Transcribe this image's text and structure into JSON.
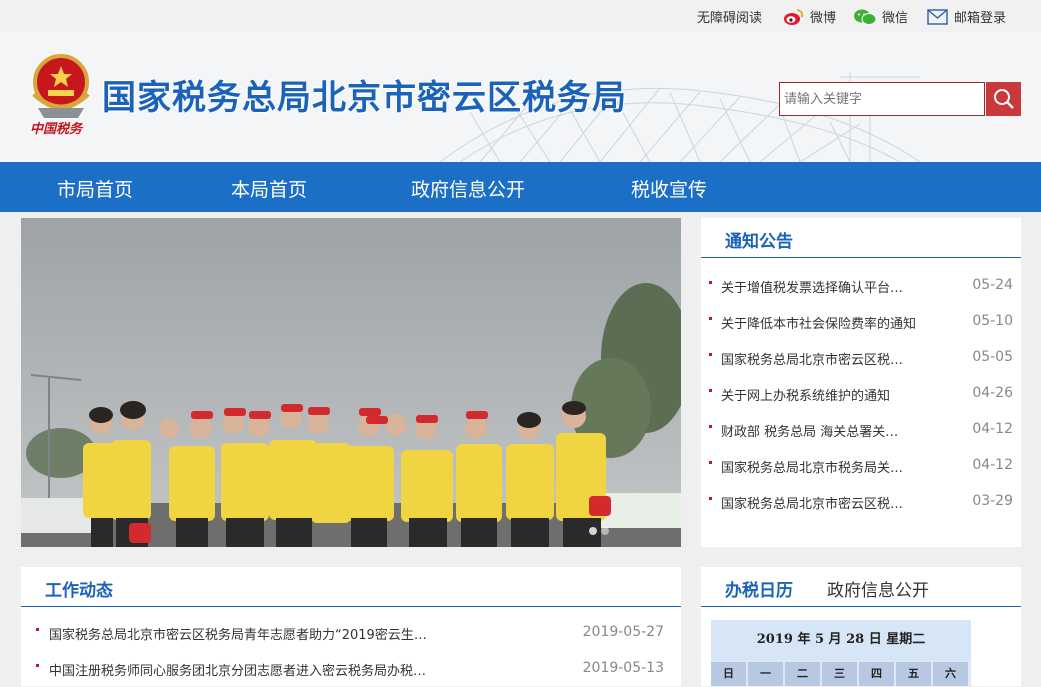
{
  "topbar": {
    "accessible": "无障碍阅读",
    "weibo": "微博",
    "wechat": "微信",
    "mail": "邮箱登录"
  },
  "header": {
    "emblem_caption": "中国税务",
    "title": "国家税务总局北京市密云区税务局",
    "search_placeholder": "请输入关键字"
  },
  "nav": [
    "市局首页",
    "本局首页",
    "政府信息公开",
    "税收宣传"
  ],
  "notice": {
    "title": "通知公告",
    "items": [
      {
        "text": "关于增值税发票选择确认平台…",
        "date": "05-24"
      },
      {
        "text": "关于降低本市社会保险费率的通知",
        "date": "05-10"
      },
      {
        "text": "国家税务总局北京市密云区税…",
        "date": "05-05"
      },
      {
        "text": "关于网上办税系统维护的通知",
        "date": "04-26"
      },
      {
        "text": "财政部 税务总局 海关总署关…",
        "date": "04-12"
      },
      {
        "text": "国家税务总局北京市税务局关…",
        "date": "04-12"
      },
      {
        "text": "国家税务总局北京市密云区税…",
        "date": "03-29"
      }
    ]
  },
  "work": {
    "title": "工作动态",
    "items": [
      {
        "text": "国家税务总局北京市密云区税务局青年志愿者助力“2019密云生…",
        "date": "2019-05-27"
      },
      {
        "text": "中国注册税务师同心服务团北京分团志愿者进入密云税务局办税…",
        "date": "2019-05-13"
      }
    ]
  },
  "calendar_panel": {
    "tab_active": "办税日历",
    "tab_other": "政府信息公开",
    "heading": "2019 年 5 月 28 日 星期二",
    "weekdays": [
      "日",
      "一",
      "二",
      "三",
      "四",
      "五",
      "六"
    ]
  },
  "colors": {
    "brand_blue": "#1b63b8",
    "nav_blue": "#1b6fc6",
    "accent_red": "#c9383a"
  }
}
